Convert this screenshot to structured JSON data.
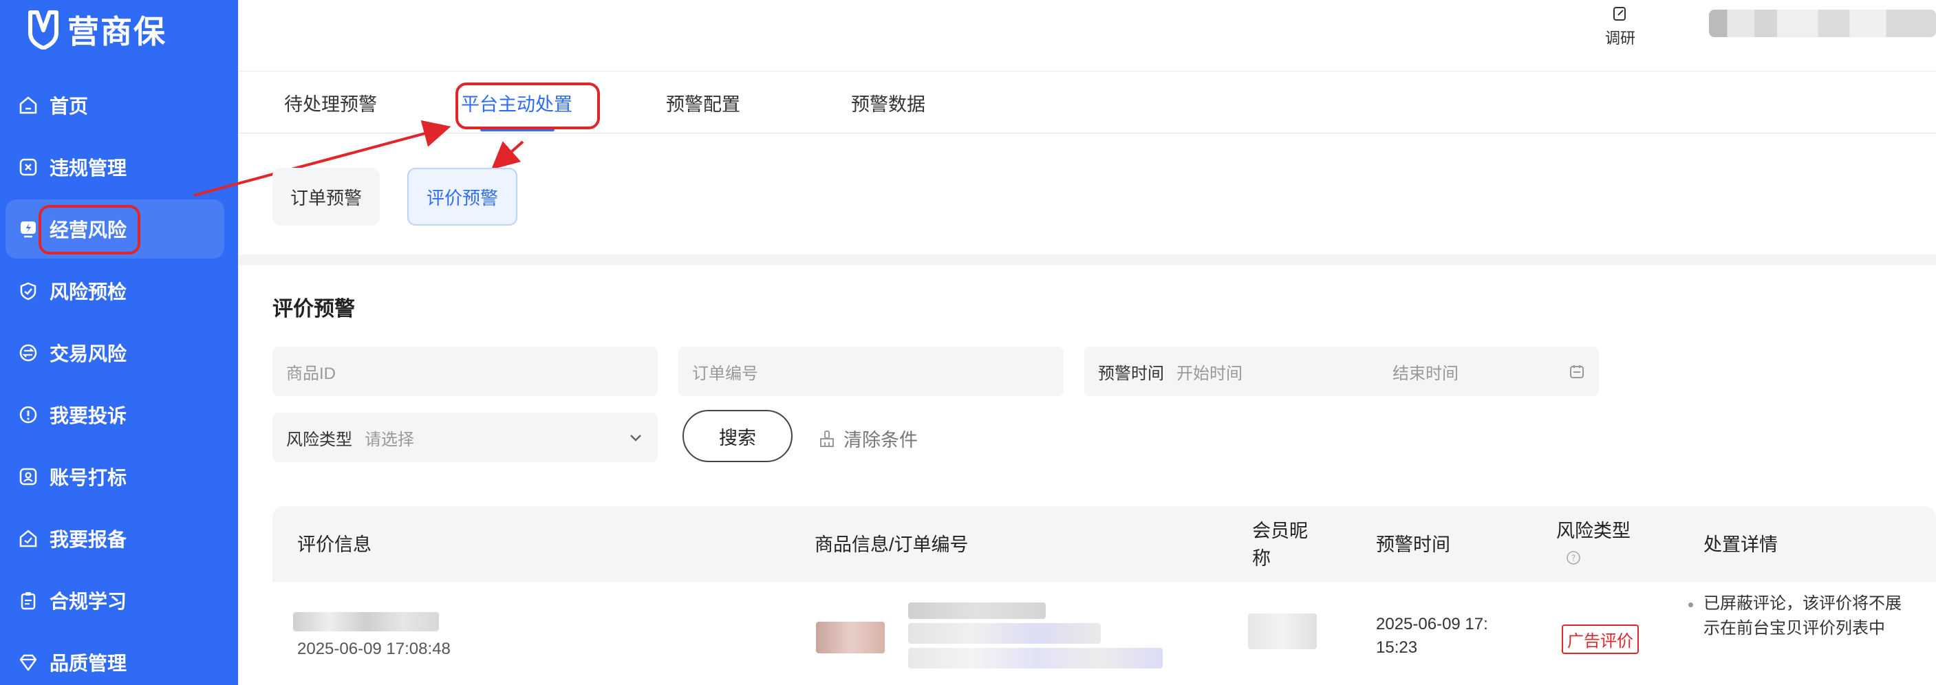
{
  "brand": {
    "name": "营商保"
  },
  "sidebar": {
    "items": [
      {
        "label": "首页",
        "icon": "home-icon"
      },
      {
        "label": "违规管理",
        "icon": "violation-icon"
      },
      {
        "label": "经营风险",
        "icon": "shield-lightning-icon",
        "active": true
      },
      {
        "label": "风险预检",
        "icon": "precheck-icon"
      },
      {
        "label": "交易风险",
        "icon": "exchange-icon"
      },
      {
        "label": "我要投诉",
        "icon": "alert-circle-icon"
      },
      {
        "label": "账号打标",
        "icon": "account-tag-icon"
      },
      {
        "label": "我要报备",
        "icon": "report-icon"
      },
      {
        "label": "合规学习",
        "icon": "clipboard-icon"
      },
      {
        "label": "品质管理",
        "icon": "diamond-icon"
      }
    ]
  },
  "header": {
    "survey_label": "调研"
  },
  "tabs": [
    {
      "label": "待处理预警"
    },
    {
      "label": "平台主动处置",
      "active": true
    },
    {
      "label": "预警配置"
    },
    {
      "label": "预警数据"
    }
  ],
  "subtabs": [
    {
      "label": "订单预警"
    },
    {
      "label": "评价预警",
      "active": true
    }
  ],
  "section": {
    "title": "评价预警"
  },
  "filters": {
    "product_id_placeholder": "商品ID",
    "order_no_placeholder": "订单编号",
    "alert_time_label": "预警时间",
    "start_time_placeholder": "开始时间",
    "end_time_placeholder": "结束时间",
    "risk_type_label": "风险类型",
    "risk_type_placeholder": "请选择",
    "search_label": "搜索",
    "clear_label": "清除条件"
  },
  "table": {
    "columns": [
      "评价信息",
      "商品信息/订单编号",
      "会员昵称",
      "预警时间",
      "风险类型",
      "处置详情"
    ],
    "rows": [
      {
        "review_time": "2025-06-09 17:08:48",
        "alert_time_line1": "2025-06-09 17:",
        "alert_time_line2": "15:23",
        "risk_type": "广告评价",
        "detail": "已屏蔽评论，该评价将不展示在前台宝贝评价列表中"
      }
    ]
  },
  "colors": {
    "primary": "#2f6bf5",
    "annotation": "#e0262b"
  }
}
